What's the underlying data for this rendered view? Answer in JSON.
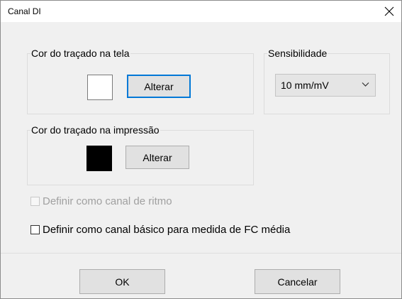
{
  "window": {
    "title": "Canal DI",
    "close_icon": "close-icon"
  },
  "screen_color": {
    "legend": "Cor do traçado na tela",
    "swatch_color": "#ffffff",
    "button_label": "Alterar"
  },
  "sensitivity": {
    "legend": "Sensibilidade",
    "selected": "10 mm/mV",
    "dropdown_icon": "chevron-down-icon"
  },
  "print_color": {
    "legend": "Cor do traçado na impressão",
    "swatch_color": "#000000",
    "button_label": "Alterar"
  },
  "options": {
    "rhythm_channel": {
      "label": "Definir como canal de ritmo",
      "checked": false,
      "enabled": false
    },
    "basic_channel": {
      "label": "Definir como canal básico para medida de FC média",
      "checked": false,
      "enabled": true
    }
  },
  "footer": {
    "ok_label": "OK",
    "cancel_label": "Cancelar"
  },
  "colors": {
    "focus_border": "#0078d7",
    "dialog_background": "#f0f0f0"
  }
}
